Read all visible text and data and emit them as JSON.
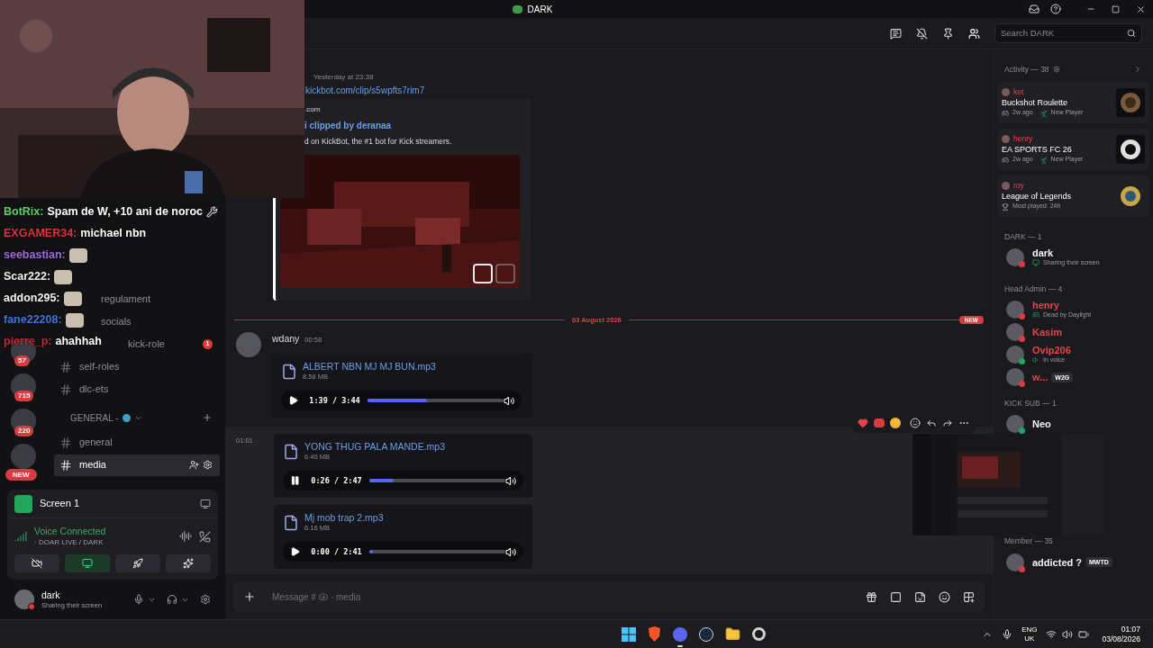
{
  "window": {
    "title": "DARK"
  },
  "header": {
    "search_placeholder": "Search DARK"
  },
  "stream_chat": [
    {
      "user": "BotRix:",
      "message": "Spam de W, +10 ani de noroc",
      "color": "#5fd35f",
      "kind": "text"
    },
    {
      "user": "EXGAMER34:",
      "message": "michael nbn",
      "color": "#e0313b",
      "kind": "text"
    },
    {
      "user": "seebastian:",
      "color": "#a36bd9",
      "kind": "emote"
    },
    {
      "user": "Scar222:",
      "color": "#f2f2f2",
      "kind": "emote"
    },
    {
      "user": "addon295:",
      "color": "#f2f2f2",
      "kind": "emote"
    },
    {
      "user": "fane22208:",
      "color": "#3d74d9",
      "kind": "emote"
    },
    {
      "user": "pierre_p:",
      "message": "ahahhah",
      "color": "#c02a3a",
      "kind": "text"
    }
  ],
  "servers": [
    {
      "badge": "57",
      "kind": "count"
    },
    {
      "badge": "715",
      "kind": "count"
    },
    {
      "badge": "220",
      "kind": "count"
    },
    {
      "badge": "NEW",
      "kind": "new"
    }
  ],
  "channels": [
    {
      "kind": "channel",
      "name": "regulament",
      "selected": false
    },
    {
      "kind": "channel",
      "name": "socials",
      "selected": false
    },
    {
      "kind": "channel",
      "name": "kick-role",
      "selected": false,
      "badge": "1"
    },
    {
      "kind": "channel",
      "name": "self-roles",
      "selected": false
    },
    {
      "kind": "channel",
      "name": "dlc-ets",
      "selected": false
    },
    {
      "kind": "category",
      "name": "GENERAL -"
    },
    {
      "kind": "channel",
      "name": "general",
      "selected": false
    },
    {
      "kind": "channel",
      "name": "media",
      "selected": true
    }
  ],
  "voice": {
    "screen": "Screen 1",
    "status": "Voice Connected",
    "channel": "· DOAR LIVE / DARK",
    "buttons": [
      {
        "kind": "camera",
        "active": false
      },
      {
        "kind": "screen",
        "active": true
      },
      {
        "kind": "activities",
        "active": false
      },
      {
        "kind": "soundboard",
        "active": false
      }
    ]
  },
  "user": {
    "name": "dark",
    "status_text": "Sharing their screen"
  },
  "clip_message": {
    "time": "Yesterday at 23:38",
    "link": "kickbot.com/clip/s5wpfts7rim7",
    "provider": ".com",
    "title": "i clipped by deranaa",
    "description": "d on KickBot, the #1 bot for Kick streamers."
  },
  "divider": {
    "date": "03 August 2026",
    "badge": "NEW"
  },
  "messages": [
    {
      "author": "wdany",
      "time": "00:58",
      "hovered": false,
      "attachments": [
        {
          "name": "ALBERT NBN MJ MJ BUN.mp3",
          "size": "8.58 MB",
          "time": "1:39 / 3:44",
          "level": 0.44,
          "playing": false
        }
      ]
    },
    {
      "time": "01:01",
      "hovered": true,
      "attachments": [
        {
          "name": "YONG THUG PALA MANDE.mp3",
          "size": "6.40 MB",
          "time": "0:26 / 2:47",
          "level": 0.18,
          "playing": true
        },
        {
          "name": "Mj mob trap 2.mp3",
          "size": "6.16 MB",
          "time": "0:00 / 2:41",
          "level": 0.03,
          "playing": false
        }
      ]
    }
  ],
  "composer": {
    "placeholder_start": "Message #",
    "placeholder_end": "· media"
  },
  "activity": {
    "title": "Activity — 38",
    "items": [
      {
        "user": "ket",
        "game": "Buckshot Roulette",
        "kind": "new_player",
        "ago": "2w ago",
        "note": "New Player"
      },
      {
        "user": "henry",
        "game": "EA SPORTS FC 26",
        "kind": "new_player",
        "ago": "2w ago",
        "note": "New Player"
      },
      {
        "user": "roy",
        "game": "League of Legends",
        "kind": "most_played",
        "note": "Most played: 24h"
      }
    ]
  },
  "member_groups": [
    {
      "title": "DARK — 1",
      "members": [
        {
          "name": "dark",
          "color": "#f2f3f5",
          "online": false,
          "kind": "screen",
          "activity": "Sharing their screen"
        }
      ]
    },
    {
      "title": "Head Admin — 4",
      "members": [
        {
          "name": "henry",
          "color": "#e8424c",
          "online": false,
          "kind": "game",
          "activity": "Dead by Daylight"
        },
        {
          "name": "Kasim",
          "color": "#e8424c",
          "online": false,
          "kind": "plain"
        },
        {
          "name": "Ovip206",
          "color": "#e8424c",
          "online": true,
          "kind": "voice",
          "activity": "In voice"
        },
        {
          "name": "w...",
          "color": "#e8424c",
          "online": false,
          "kind": "plain",
          "tag": "W2G"
        }
      ]
    },
    {
      "title": "KICK SUB — 1",
      "members": [
        {
          "name": "Neo",
          "color": "#f2f3f5",
          "online": true,
          "kind": "plain"
        }
      ]
    },
    {
      "title": "Member — 35",
      "members": [
        {
          "name": "addicted ?",
          "color": "#f2f3f5",
          "online": false,
          "kind": "plain",
          "tag": "MWTD"
        }
      ]
    }
  ],
  "taskbar": {
    "apps": [
      {
        "kind": "start"
      },
      {
        "kind": "shield"
      },
      {
        "kind": "chat",
        "running": true
      },
      {
        "kind": "round"
      },
      {
        "kind": "folder"
      },
      {
        "kind": "ring"
      }
    ],
    "lang": "ENG",
    "region": "UK",
    "time": "01:07",
    "date": "03/08/2026"
  }
}
